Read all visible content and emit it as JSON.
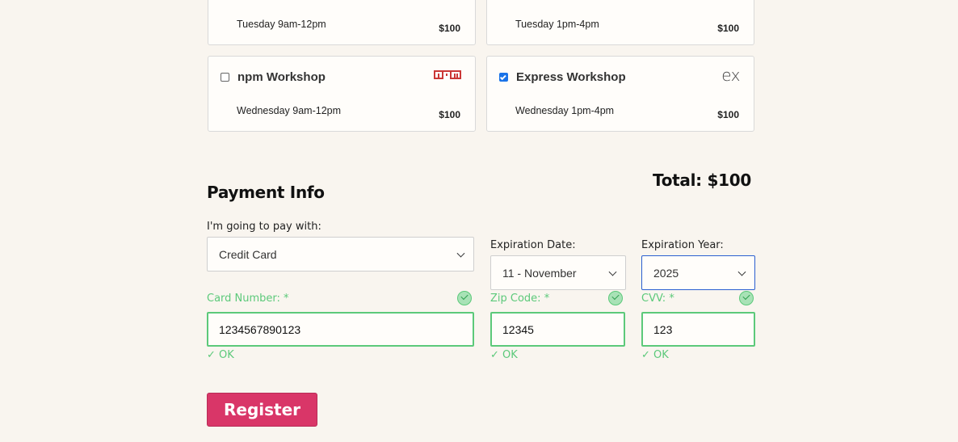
{
  "workshops": {
    "top_left": {
      "time": "Tuesday 9am-12pm",
      "price": "$100"
    },
    "top_right": {
      "time": "Tuesday 1pm-4pm",
      "price": "$100"
    },
    "npm": {
      "name": "npm Workshop",
      "time": "Wednesday 9am-12pm",
      "price": "$100",
      "checked": false,
      "logo": "npm-logo"
    },
    "express": {
      "name": "Express Workshop",
      "time": "Wednesday 1pm-4pm",
      "price": "$100",
      "checked": true,
      "logo_text": "ex"
    }
  },
  "payment": {
    "title": "Payment Info",
    "total": "Total: $100",
    "pay_with_label": "I'm going to pay with:",
    "pay_with_value": "Credit Card",
    "exp_date_label": "Expiration Date:",
    "exp_date_value": "11 - November",
    "exp_year_label": "Expiration Year:",
    "exp_year_value": "2025",
    "card_label": "Card Number: *",
    "card_value": "1234567890123",
    "zip_label": "Zip Code: *",
    "zip_value": "12345",
    "cvv_label": "CVV: *",
    "cvv_value": "123",
    "ok_text": "✓ OK"
  },
  "register_label": "Register",
  "colors": {
    "background": "#f9f5ef",
    "valid_green": "#5cc97a",
    "register_pink": "#d93668",
    "npm_red": "#cb3837",
    "focus_blue": "#2b5fd0"
  }
}
